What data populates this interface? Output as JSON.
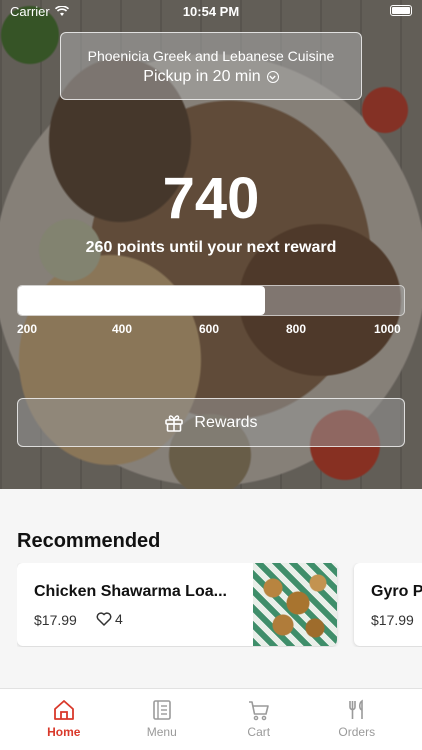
{
  "status_bar": {
    "carrier": "Carrier",
    "time": "10:54 PM"
  },
  "restaurant": {
    "name": "Phoenicia Greek and Lebanese Cuisine",
    "pickup": "Pickup in 20 min"
  },
  "points": {
    "value": "740",
    "subtitle": "260 points until your next reward",
    "progress_fraction": 0.64
  },
  "progress_ticks": [
    "200",
    "400",
    "600",
    "800",
    "1000"
  ],
  "rewards_button": {
    "label": "Rewards"
  },
  "recommended": {
    "title": "Recommended",
    "items": [
      {
        "name": "Chicken Shawarma Loa...",
        "price": "$17.99",
        "likes": "4"
      },
      {
        "name": "Gyro P",
        "price": "$17.99"
      }
    ]
  },
  "tabbar": {
    "accent_color": "#d9392b",
    "tabs": [
      {
        "label": "Home",
        "icon": "home-icon",
        "active": true
      },
      {
        "label": "Menu",
        "icon": "menu-icon",
        "active": false
      },
      {
        "label": "Cart",
        "icon": "cart-icon",
        "active": false
      },
      {
        "label": "Orders",
        "icon": "orders-icon",
        "active": false
      }
    ]
  }
}
